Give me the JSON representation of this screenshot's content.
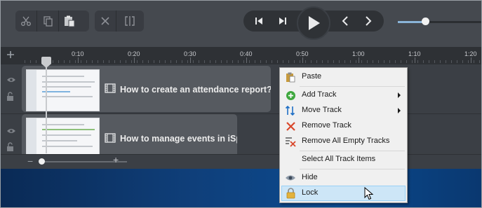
{
  "toolbar": {
    "edit_icons": [
      "scissors-icon",
      "copy-icon",
      "paste-icon"
    ],
    "split_icons": [
      "cut-icon",
      "split-icon"
    ],
    "playback_icons": [
      "skip-back-icon",
      "step-forward-icon",
      "play-icon",
      "prev-marker-icon",
      "next-marker-icon"
    ],
    "zoom_level": 0.32
  },
  "ruler": {
    "ticks": [
      "0:10",
      "0:20",
      "0:30",
      "0:40",
      "0:50",
      "1:00",
      "1:10",
      "1:20"
    ]
  },
  "tracks": [
    {
      "clip_title": "How to create an attendance report?"
    },
    {
      "clip_title": "How to manage events in iSp"
    }
  ],
  "timeline_zoom": {
    "minus": "−",
    "plus": "+"
  },
  "context_menu": {
    "items": [
      {
        "label": "Paste",
        "icon": "paste-icon"
      },
      {
        "label": "Add Track",
        "icon": "add-circle-icon",
        "submenu": true
      },
      {
        "label": "Move Track",
        "icon": "move-arrows-icon",
        "submenu": true
      },
      {
        "label": "Remove Track",
        "icon": "remove-x-icon"
      },
      {
        "label": "Remove All Empty Tracks",
        "icon": "remove-empty-tracks-icon"
      },
      {
        "label": "Select All Track Items"
      },
      {
        "label": "Hide",
        "icon": "eye-icon"
      },
      {
        "label": "Lock",
        "icon": "lock-icon",
        "highlighted": true
      }
    ]
  }
}
